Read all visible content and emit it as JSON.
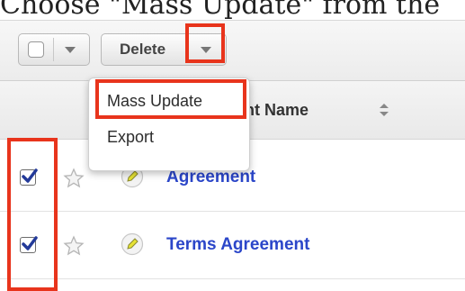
{
  "caption": "Choose \"Mass Update\" from the",
  "toolbar": {
    "delete_label": "Delete"
  },
  "dropdown": {
    "items": [
      {
        "label": "Mass Update",
        "highlighted": true
      },
      {
        "label": "Export",
        "highlighted": false
      }
    ]
  },
  "table": {
    "column_label": "nt Name",
    "rows": [
      {
        "name": "Agreement",
        "checked": true,
        "favorite": false
      },
      {
        "name": "Terms Agreement",
        "checked": true,
        "favorite": false
      }
    ]
  },
  "colors": {
    "highlight": "#e8341c",
    "link": "#2b46c9",
    "edit_icon": "#e6e234"
  },
  "icons": [
    "chevron-down-icon",
    "sort-icon",
    "checkbox-checked-icon",
    "star-icon",
    "pencil-edit-icon"
  ]
}
